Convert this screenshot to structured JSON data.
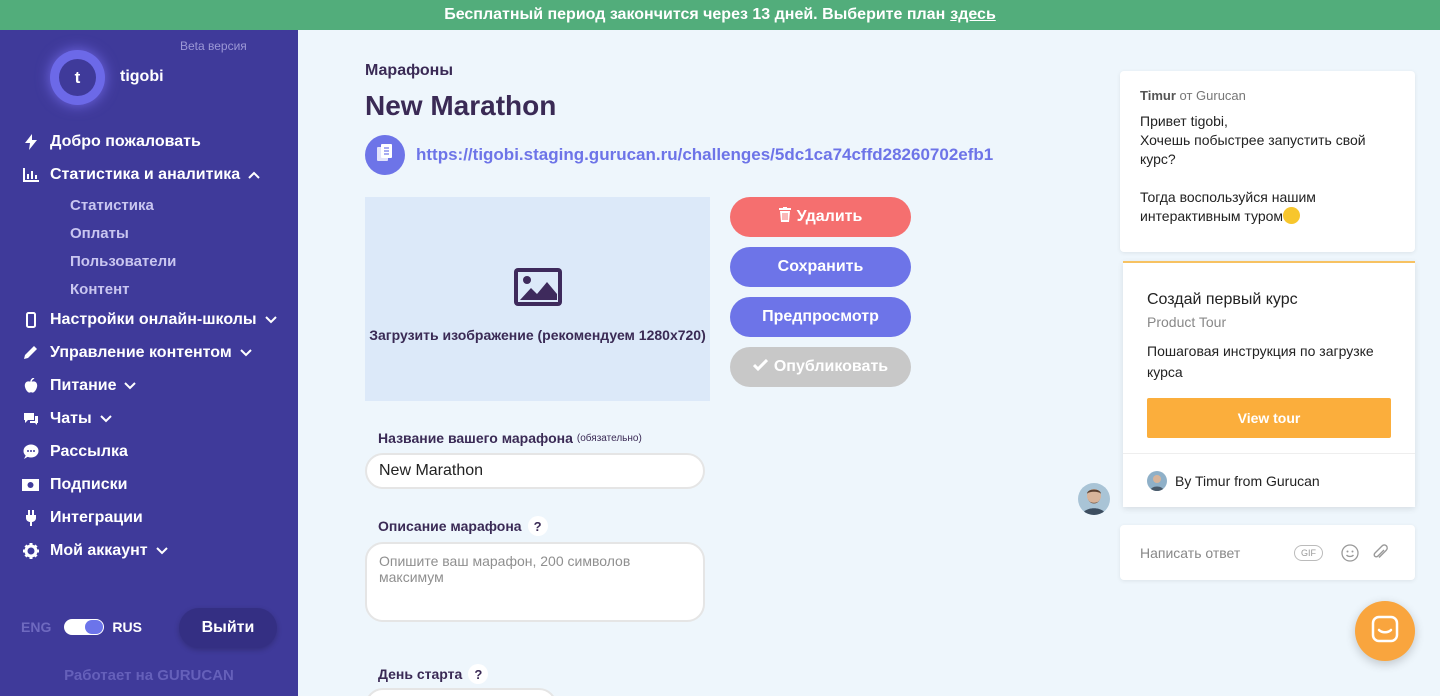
{
  "banner": {
    "text": "Бесплатный период закончится через 13 дней. Выберите план",
    "link": "здесь",
    "color": "#52ad7b"
  },
  "sidebar": {
    "beta": "Beta версия",
    "avatar_letter": "t",
    "username": "tigobi",
    "items": [
      {
        "label": "Добро пожаловать",
        "icon": "bolt-icon",
        "chevron": ""
      },
      {
        "label": "Статистика и аналитика",
        "icon": "bar-chart-icon",
        "chevron": "up"
      },
      {
        "label": "Настройки онлайн-школы",
        "icon": "phone-icon",
        "chevron": "down"
      },
      {
        "label": "Управление контентом",
        "icon": "pencil-icon",
        "chevron": "down"
      },
      {
        "label": "Питание",
        "icon": "apple-icon",
        "chevron": "down"
      },
      {
        "label": "Чаты",
        "icon": "chat-icon",
        "chevron": "down"
      },
      {
        "label": "Рассылка",
        "icon": "speech-bubble-icon",
        "chevron": ""
      },
      {
        "label": "Подписки",
        "icon": "money-icon",
        "chevron": ""
      },
      {
        "label": "Интеграции",
        "icon": "plug-icon",
        "chevron": ""
      },
      {
        "label": "Мой аккаунт",
        "icon": "gear-icon",
        "chevron": "down"
      }
    ],
    "subitems": [
      "Статистика",
      "Оплаты",
      "Пользователи",
      "Контент"
    ],
    "lang_eng": "ENG",
    "lang_rus": "RUS",
    "logout": "Выйти",
    "powered": "Работает на GURUCAN",
    "color": "#3f3a9a"
  },
  "main": {
    "breadcrumb": "Марафоны",
    "title": "New Marathon",
    "url": "https://tigobi.staging.gurucan.ru/challenges/5dc1ca74cffd28260702efb1",
    "upload_label": "Загрузить изображение (рекомендуем 1280x720)",
    "buttons": {
      "delete": "Удалить",
      "save": "Сохранить",
      "preview": "Предпросмотр",
      "publish": "Опубликовать"
    },
    "name_label": "Название вашего марафона",
    "name_required": "(обязательно)",
    "name_value": "New Marathon",
    "desc_label": "Описание марафона",
    "desc_placeholder": "Опишите ваш марафон, 200 символов максимум",
    "start_label": "День старта",
    "help": "?",
    "accent": "#6d74e8",
    "danger": "#f56f6f"
  },
  "chat": {
    "from_name": "Timur",
    "from_rest": "от Gurucan",
    "lines": [
      "Привет tigobi,",
      "Хочешь побыстрее запустить свой курс?"
    ],
    "lines2": [
      "Тогда воспользуйся нашим",
      "интерактивным туром"
    ],
    "tour_title": "Создай первый курс",
    "tour_sub": "Product Tour",
    "tour_desc": "Пошаговая инструкция по загрузке курса",
    "tour_button": "View tour",
    "tour_by": "By Timur from Gurucan",
    "reply_placeholder": "Написать ответ",
    "gif": "GIF",
    "launcher_color": "#f9a53e"
  }
}
